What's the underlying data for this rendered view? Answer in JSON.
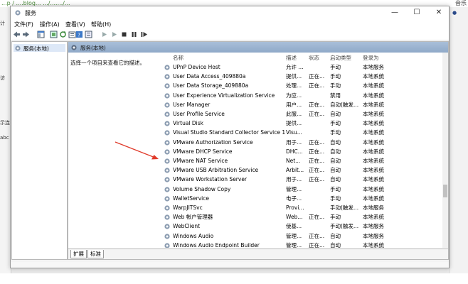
{
  "background": {
    "top_url": "...p / ....blog... .../......./...",
    "top_right": "音乐"
  },
  "window": {
    "title": "服务",
    "menu": [
      "文件(F)",
      "操作(A)",
      "查看(V)",
      "帮助(H)"
    ],
    "controls": {
      "minimize": "—",
      "maximize": "☐",
      "close": "✕"
    }
  },
  "tree": {
    "root_label": "服务(本地)"
  },
  "panel": {
    "header": "服务(本地)",
    "description": "选择一个项目来查看它的描述。",
    "columns": {
      "name": "名称",
      "desc": "描述",
      "status": "状态",
      "start": "启动类型",
      "logon": "登录为"
    },
    "rows": [
      {
        "name": "UPnP Device Host",
        "desc": "允许 ...",
        "status": "",
        "start": "手动",
        "logon": "本地服务"
      },
      {
        "name": "User Data Access_409880a",
        "desc": "提供...",
        "status": "正在...",
        "start": "手动",
        "logon": "本地系统"
      },
      {
        "name": "User Data Storage_409880a",
        "desc": "处理...",
        "status": "正在...",
        "start": "手动",
        "logon": "本地系统"
      },
      {
        "name": "User Experience Virtualization Service",
        "desc": "为应...",
        "status": "",
        "start": "禁用",
        "logon": "本地系统"
      },
      {
        "name": "User Manager",
        "desc": "用户...",
        "status": "正在...",
        "start": "自动(触发...",
        "logon": "本地系统"
      },
      {
        "name": "User Profile Service",
        "desc": "此服...",
        "status": "正在...",
        "start": "自动",
        "logon": "本地系统"
      },
      {
        "name": "Virtual Disk",
        "desc": "提供...",
        "status": "",
        "start": "手动",
        "logon": "本地系统"
      },
      {
        "name": "Visual Studio Standard Collector Service 150",
        "desc": "Visu...",
        "status": "",
        "start": "手动",
        "logon": "本地系统"
      },
      {
        "name": "VMware Authorization Service",
        "desc": "用于...",
        "status": "正在...",
        "start": "自动",
        "logon": "本地系统"
      },
      {
        "name": "VMware DHCP Service",
        "desc": "DHC...",
        "status": "正在...",
        "start": "自动",
        "logon": "本地系统"
      },
      {
        "name": "VMware NAT Service",
        "desc": "Net...",
        "status": "正在...",
        "start": "自动",
        "logon": "本地系统"
      },
      {
        "name": "VMware USB Arbitration Service",
        "desc": "Arbit...",
        "status": "正在...",
        "start": "自动",
        "logon": "本地系统"
      },
      {
        "name": "VMware Workstation Server",
        "desc": "用于...",
        "status": "正在...",
        "start": "自动",
        "logon": "本地系统"
      },
      {
        "name": "Volume Shadow Copy",
        "desc": "管理...",
        "status": "",
        "start": "手动",
        "logon": "本地系统"
      },
      {
        "name": "WalletService",
        "desc": "电子...",
        "status": "",
        "start": "手动",
        "logon": "本地系统"
      },
      {
        "name": "WarpJITSvc",
        "desc": "Provi...",
        "status": "",
        "start": "手动(触发...",
        "logon": "本地服务"
      },
      {
        "name": "Web 帐户管理器",
        "desc": "Web...",
        "status": "正在...",
        "start": "手动",
        "logon": "本地系统"
      },
      {
        "name": "WebClient",
        "desc": "使基...",
        "status": "",
        "start": "手动(触发...",
        "logon": "本地服务"
      },
      {
        "name": "Windows Audio",
        "desc": "管理...",
        "status": "正在...",
        "start": "自动",
        "logon": "本地服务"
      },
      {
        "name": "Windows Audio Endpoint Builder",
        "desc": "管理...",
        "status": "正在...",
        "start": "自动",
        "logon": "本地系统"
      }
    ]
  },
  "tabs": [
    "扩展",
    "标准"
  ],
  "colors": {
    "header": "#9bb3d1",
    "accent": "#3c78c8",
    "arrow": "#e03a2a"
  }
}
